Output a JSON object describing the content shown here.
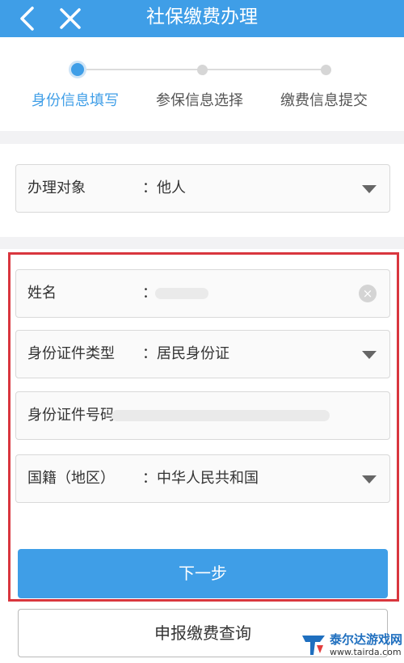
{
  "header": {
    "title": "社保缴费办理",
    "back_icon": "chevron-left-icon",
    "close_icon": "close-icon"
  },
  "steps": [
    {
      "label": "身份信息填写",
      "state": "active"
    },
    {
      "label": "参保信息选择",
      "state": "inactive"
    },
    {
      "label": "缴费信息提交",
      "state": "inactive"
    }
  ],
  "form": {
    "handling_target": {
      "label": "办理对象",
      "colon": "：",
      "value": "他人"
    },
    "name": {
      "label": "姓名",
      "colon": "：",
      "value": ""
    },
    "id_type": {
      "label": "身份证件类型",
      "colon": "：",
      "value": "居民身份证"
    },
    "id_number": {
      "label": "身份证件号码",
      "colon": "：",
      "value": ""
    },
    "nationality": {
      "label": "国籍（地区）",
      "colon": "：",
      "value": "中华人民共和国"
    }
  },
  "buttons": {
    "next": "下一步",
    "query": "申报缴费查询"
  },
  "watermark": {
    "title": "泰尔达游戏网",
    "url": "www.tairda.com"
  },
  "colors": {
    "primary": "#3f9ee7",
    "highlight_border": "#d9363e",
    "background": "#f2f2f4"
  }
}
